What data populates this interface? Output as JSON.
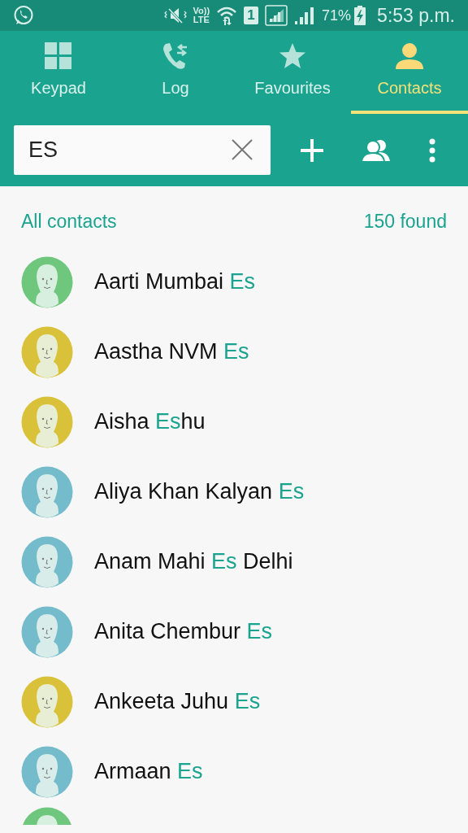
{
  "status_bar": {
    "volte_top": "Vo))",
    "volte_bottom": "LTE",
    "sim": "1",
    "battery_percent": "71%",
    "time": "5:53 p.m."
  },
  "tabs": [
    {
      "label": "Keypad",
      "kind": "keypad",
      "selected": false
    },
    {
      "label": "Log",
      "kind": "log",
      "selected": false
    },
    {
      "label": "Favourites",
      "kind": "favourites",
      "selected": false
    },
    {
      "label": "Contacts",
      "kind": "contacts",
      "selected": true
    }
  ],
  "search": {
    "value": "ES"
  },
  "list_header": {
    "title": "All contacts",
    "count": "150 found"
  },
  "contacts": [
    {
      "color": "#6fc77d",
      "name": [
        {
          "text": "Aarti Mumbai ",
          "match": false
        },
        {
          "text": "Es",
          "match": true
        }
      ]
    },
    {
      "color": "#d9c23a",
      "name": [
        {
          "text": "Aastha NVM ",
          "match": false
        },
        {
          "text": "Es",
          "match": true
        }
      ]
    },
    {
      "color": "#d9c23a",
      "name": [
        {
          "text": "Aisha ",
          "match": false
        },
        {
          "text": "Es",
          "match": true
        },
        {
          "text": "hu",
          "match": false
        }
      ]
    },
    {
      "color": "#74bccb",
      "name": [
        {
          "text": "Aliya Khan Kalyan ",
          "match": false
        },
        {
          "text": "Es",
          "match": true
        }
      ]
    },
    {
      "color": "#74bccb",
      "name": [
        {
          "text": "Anam Mahi ",
          "match": false
        },
        {
          "text": "Es",
          "match": true
        },
        {
          "text": " Delhi",
          "match": false
        }
      ]
    },
    {
      "color": "#74bccb",
      "name": [
        {
          "text": "Anita Chembur ",
          "match": false
        },
        {
          "text": "Es",
          "match": true
        }
      ]
    },
    {
      "color": "#d9c23a",
      "name": [
        {
          "text": "Ankeeta Juhu ",
          "match": false
        },
        {
          "text": "Es",
          "match": true
        }
      ]
    },
    {
      "color": "#74bccb",
      "name": [
        {
          "text": "Armaan ",
          "match": false
        },
        {
          "text": "Es",
          "match": true
        }
      ]
    },
    {
      "color": "#6fc77d"
    }
  ]
}
